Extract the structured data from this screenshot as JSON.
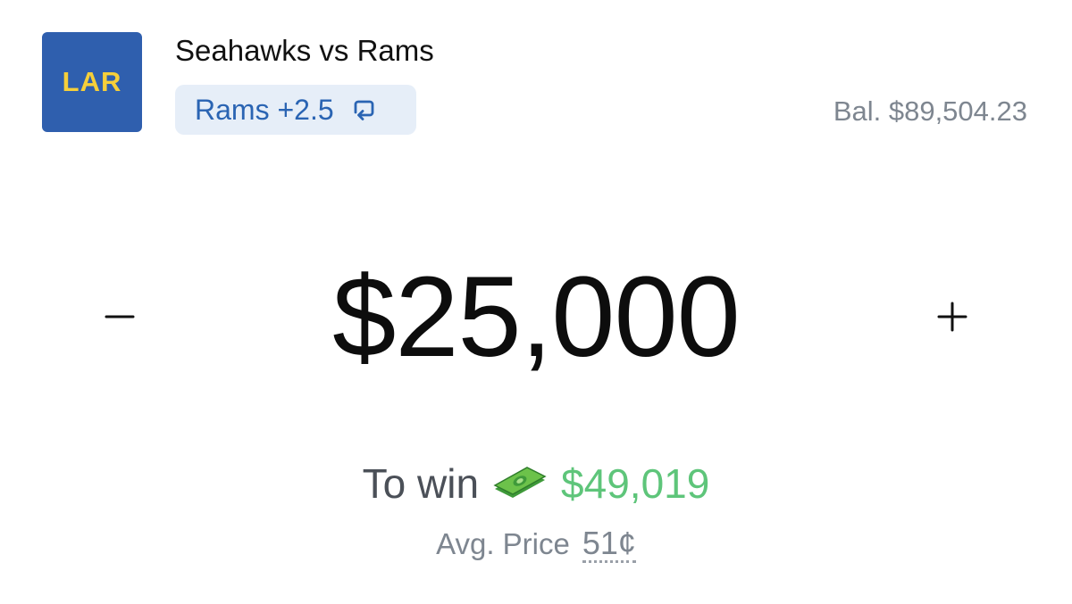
{
  "team_logo": {
    "abbr": "LAR",
    "bg_color": "#2f5fae",
    "text_color": "#f6cf3a"
  },
  "header": {
    "title": "Seahawks vs Rams",
    "selection": {
      "label": "Rams +2.5",
      "icon": "swap-icon"
    },
    "balance": "Bal. $89,504.23"
  },
  "stepper": {
    "minus_label": "−",
    "plus_label": "+",
    "amount": "$25,000"
  },
  "payout": {
    "to_win_label": "To win",
    "icon": "money-icon",
    "to_win_value": "$49,019",
    "avg_price_label": "Avg. Price",
    "avg_price_value": "51¢"
  },
  "colors": {
    "accent_blue": "#2a64b3",
    "chip_bg": "#e6eef8",
    "win_green": "#5ec57a",
    "muted_gray": "#7e8690"
  }
}
